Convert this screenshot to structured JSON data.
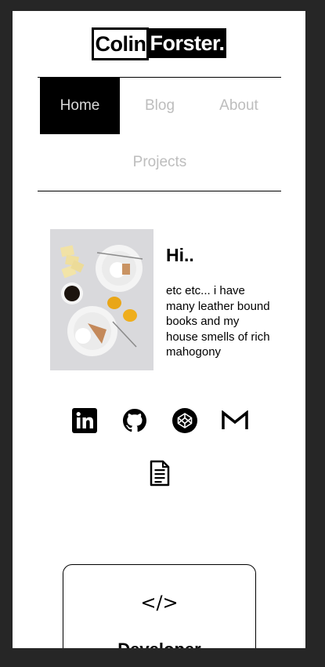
{
  "logo": {
    "first": "Colin",
    "last": "Forster."
  },
  "nav": {
    "items": [
      {
        "label": "Home",
        "active": true
      },
      {
        "label": "Blog",
        "active": false
      },
      {
        "label": "About",
        "active": false
      },
      {
        "label": "Projects",
        "active": false
      }
    ]
  },
  "hero": {
    "title": "Hi..",
    "text": "etc etc... i have many leather bound books and my house smells of rich mahogony"
  },
  "social": [
    {
      "icon": "linkedin-icon"
    },
    {
      "icon": "github-icon"
    },
    {
      "icon": "codepen-icon"
    },
    {
      "icon": "gmail-icon"
    },
    {
      "icon": "resume-icon"
    }
  ],
  "card": {
    "icon_text": "</>",
    "title": "Developer"
  },
  "colors": {
    "background": "#262626",
    "page": "#ffffff",
    "accent": "#000000",
    "nav_inactive": "#bdbdbd"
  }
}
